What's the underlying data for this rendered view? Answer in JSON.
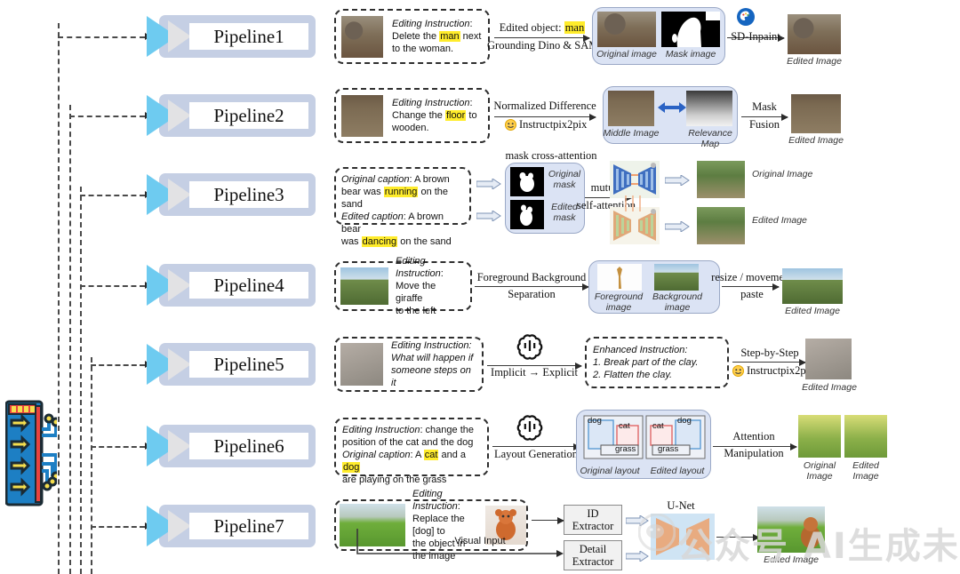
{
  "hub": {
    "name": "pipeline-hub-icon"
  },
  "pipelines": [
    {
      "label": "Pipeline1"
    },
    {
      "label": "Pipeline2"
    },
    {
      "label": "Pipeline3"
    },
    {
      "label": "Pipeline4"
    },
    {
      "label": "Pipeline5"
    },
    {
      "label": "Pipeline6"
    },
    {
      "label": "Pipeline7"
    }
  ],
  "p1": {
    "instr_title": "Editing Instruction",
    "instr_l1_a": "Delete the ",
    "instr_l1_hl": "man",
    "instr_l1_b": " next",
    "instr_l2": "to the woman.",
    "arrow_top": "Edited object: ",
    "arrow_top_hl": "man",
    "arrow_bottom": "Grounding Dino & SAM",
    "panel_cap_left": "Original  image",
    "panel_cap_right": "Mask image",
    "arrow2": "SD-Inpaint",
    "out_cap": "Edited Image",
    "icon": "sd-inpaint-icon"
  },
  "p2": {
    "instr_title": "Editing Instruction",
    "instr_l1_a": "Change the ",
    "instr_l1_hl": "floor",
    "instr_l1_b": " to",
    "instr_l2": "wooden.",
    "arrow_top": "Normalized Difference",
    "arrow_bottom": "Instructpix2pix",
    "panel_cap_left": "Middle Image",
    "panel_cap_right": "Relevance Map",
    "arrow2_l1": "Mask",
    "arrow2_l2": "Fusion",
    "out_cap": "Edited Image",
    "icon": "hugging-face-icon"
  },
  "p3": {
    "cap_orig_label": "Original caption",
    "cap_orig_a": ": A brown",
    "cap_orig_l2_a": "bear was ",
    "cap_orig_hl": "running",
    "cap_orig_l2_b": " on the sand",
    "cap_edit_label": "Edited caption",
    "cap_edit_a": ": A brown bear",
    "cap_edit_l2_a": "was ",
    "cap_edit_hl": "dancing",
    "cap_edit_l2_b": " on the sand",
    "panel_title": "mask cross-attention",
    "mask_cap_1_l1": "Original",
    "mask_cap_1_l2": "mask",
    "mask_cap_2_l1": "Edited",
    "mask_cap_2_l2": "mask",
    "arrow_l1": "mutual",
    "arrow_l2": "self-attention",
    "out_cap_1": "Original Image",
    "out_cap_2": "Edited Image"
  },
  "p4": {
    "instr_title": "Editing Instruction",
    "instr_l1": "Move the giraffe",
    "instr_l2": "to the left",
    "arrow_l1": "Foreground Background",
    "arrow_l2": "Separation",
    "panel_cap_left_l1": "Foreground",
    "panel_cap_left_l2": "image",
    "panel_cap_right_l1": "Background",
    "panel_cap_right_l2": "image",
    "arrow2_l1": "resize / movement",
    "arrow2_l2": "paste",
    "out_cap": "Edited Image"
  },
  "p5": {
    "instr_title": "Editing Instruction:",
    "instr_l1": "What will happen if",
    "instr_l2": "someone steps on it",
    "arrow_label": "Implicit → Explicit",
    "icon": "openai-icon",
    "enh_title": "Enhanced Instruction:",
    "enh_1": "1.   Break part of the clay.",
    "enh_2": "2.   Flatten the clay.",
    "arrow2_top": "Step-by-Step",
    "arrow2_bottom": "Instructpix2pix",
    "icon2": "hugging-face-icon",
    "out_cap": "Edited Image"
  },
  "p6": {
    "instr_label": "Editing Instruction",
    "instr_l1": ": change the",
    "instr_l2": "position of the cat and the dog",
    "cap_label": "Original caption",
    "cap_a": ": A ",
    "cap_hl1": "cat",
    "cap_b": " and a ",
    "cap_hl2": "dog",
    "cap_l2": "are playing on the grass",
    "arrow_label": "Layout Generation",
    "icon": "openai-icon",
    "layout_tags": [
      "dog",
      "cat",
      "grass"
    ],
    "panel_cap_left": "Original layout",
    "panel_cap_right": "Edited layout",
    "arrow2_l1": "Attention",
    "arrow2_l2": "Manipulation",
    "out_cap_1_l1": "Original",
    "out_cap_1_l2": "Image",
    "out_cap_2_l1": "Edited",
    "out_cap_2_l2": "Image"
  },
  "p7": {
    "instr_label": "Editing Instruction",
    "instr_l1": ":",
    "instr_l2": "Replace the [dog] to",
    "instr_l3": "the object in the image",
    "visual_input_cap": "Visual Input",
    "box1_l1": "ID",
    "box1_l2": "Extractor",
    "box2_l1": "Detail",
    "box2_l2": "Extractor",
    "unet_label": "U-Net",
    "out_cap": "Edited Image"
  },
  "watermark": {
    "text": "公众号   AI生成未来"
  },
  "colors": {
    "panel_bg": "#dbe3f4",
    "badge_plate": "#c5cfe4",
    "badge_tri": "#6ecbf0",
    "highlight": "#ffec2b",
    "dash": "#4a4a4a"
  }
}
